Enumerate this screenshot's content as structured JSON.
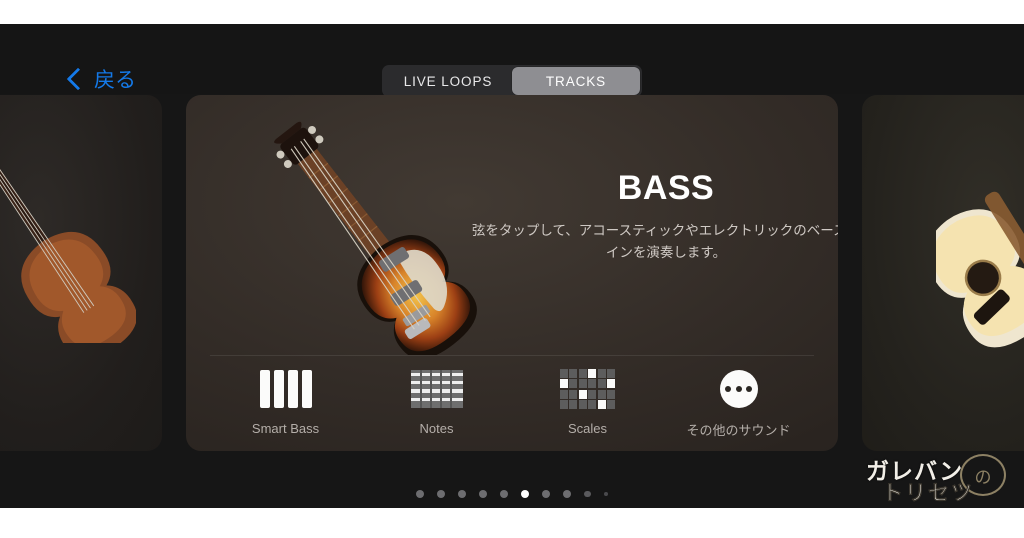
{
  "app": {
    "nav": {
      "back_label": "戻る",
      "back_icon": "chevron-left-icon"
    },
    "segmented_control": {
      "options": [
        "LIVE LOOPS",
        "TRACKS"
      ],
      "selected": "TRACKS"
    }
  },
  "carousel": {
    "active_card": {
      "title": "BASS",
      "description": "弦をタップして、アコースティックやエレクトリックのベースラインを演奏します。",
      "instrument_art": "violin-bass-guitar",
      "options": [
        {
          "label": "Smart Bass",
          "icon": "bass-strings-icon"
        },
        {
          "label": "Notes",
          "icon": "fretboard-icon"
        },
        {
          "label": "Scales",
          "icon": "scales-grid-icon"
        },
        {
          "label": "その他のサウンド",
          "icon": "more-ellipsis-icon"
        }
      ]
    },
    "previous_card": {
      "instrument_art": "violin"
    },
    "next_card": {
      "instrument_art": "acoustic-guitar"
    },
    "page_count": 10,
    "current_page": 6
  },
  "watermark": {
    "line1": "ガレバン",
    "line2": "トリセツ",
    "bubble": "の"
  },
  "colors": {
    "accent_blue": "#1479e8",
    "card_bg": "#332c27",
    "screen_bg": "#161616",
    "selected_segment": "#8e8e92"
  }
}
